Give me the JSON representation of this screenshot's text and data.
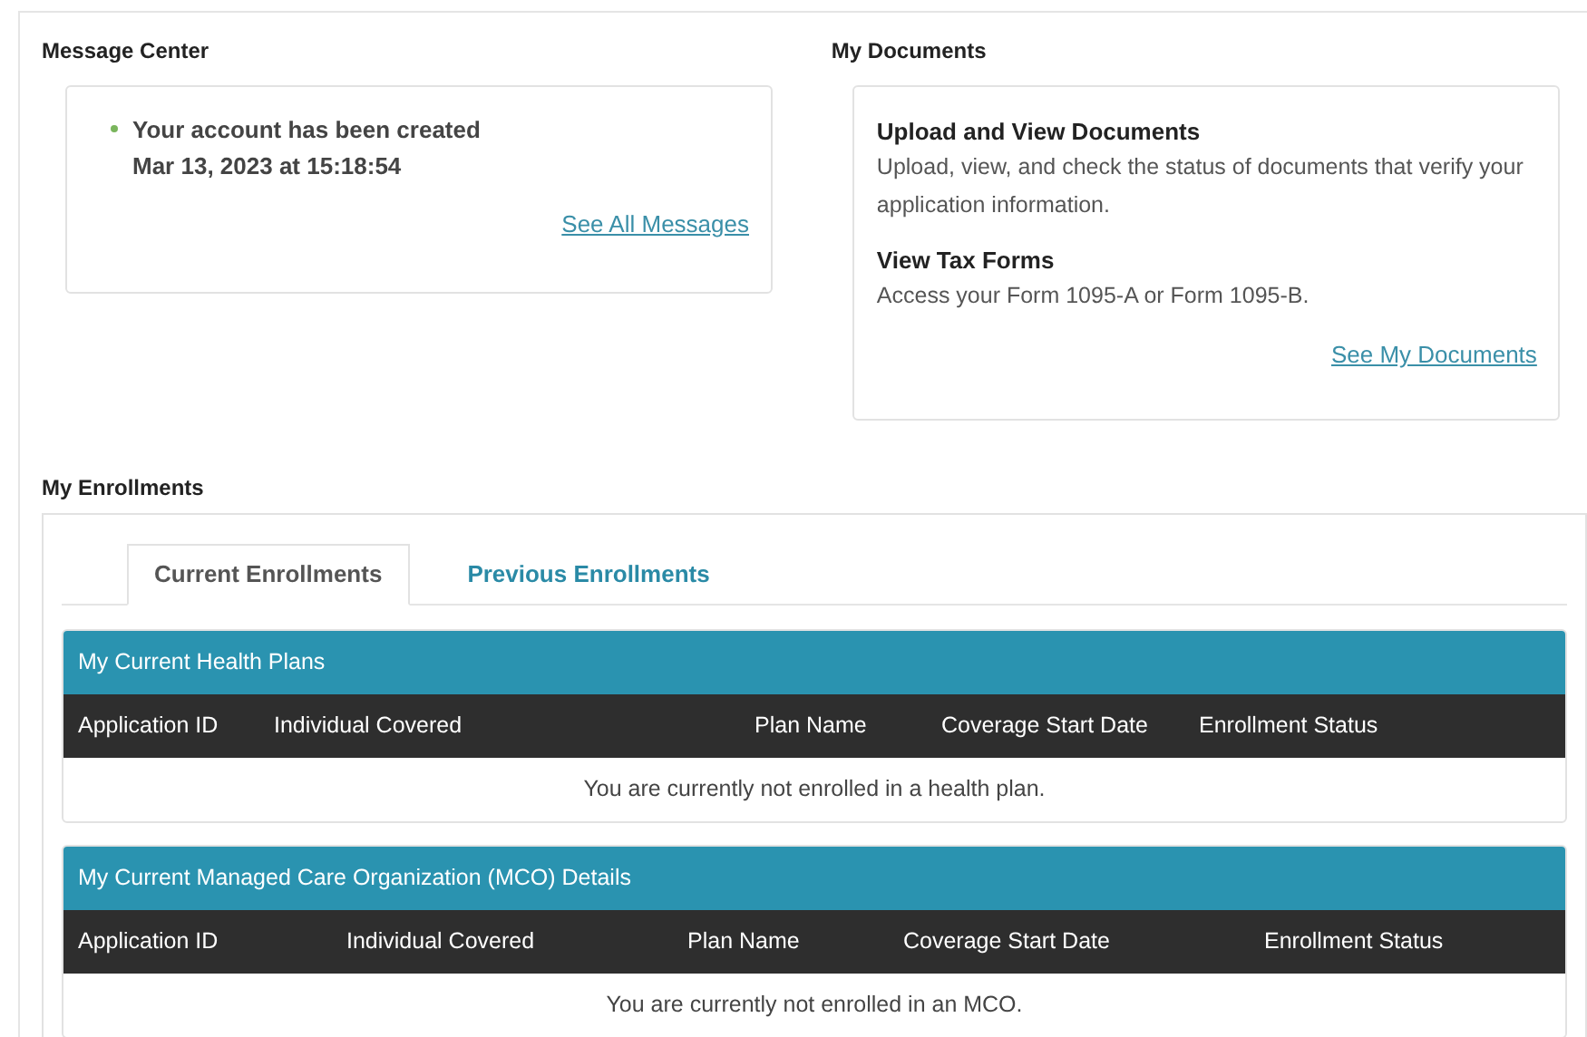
{
  "message_center": {
    "title": "Message Center",
    "messages": [
      {
        "text": "Your account has been created",
        "date": "Mar 13, 2023 at 15:18:54",
        "color": "#7ab55c"
      }
    ],
    "link": "See All Messages"
  },
  "my_documents": {
    "title": "My Documents",
    "sections": [
      {
        "heading": "Upload and View Documents",
        "text": "Upload, view, and check the status of documents that verify your application information."
      },
      {
        "heading": "View Tax Forms",
        "text": "Access your Form 1095-A or Form 1095-B."
      }
    ],
    "link": "See My Documents"
  },
  "my_enrollments": {
    "title": "My Enrollments",
    "tabs": [
      {
        "label": "Current Enrollments",
        "selected": true
      },
      {
        "label": "Previous Enrollments",
        "selected": false
      }
    ],
    "tables": [
      {
        "title": "My Current Health Plans",
        "columns": [
          "Application ID",
          "Individual Covered",
          "Plan Name",
          "Coverage Start Date",
          "Enrollment Status"
        ],
        "empty_message": "You are currently not enrolled in a health plan."
      },
      {
        "title": "My Current Managed Care Organization (MCO) Details",
        "columns": [
          "Application ID",
          "Individual Covered",
          "Plan Name",
          "Coverage Start Date",
          "Enrollment Status"
        ],
        "empty_message": "You are currently not enrolled in an MCO."
      }
    ]
  }
}
